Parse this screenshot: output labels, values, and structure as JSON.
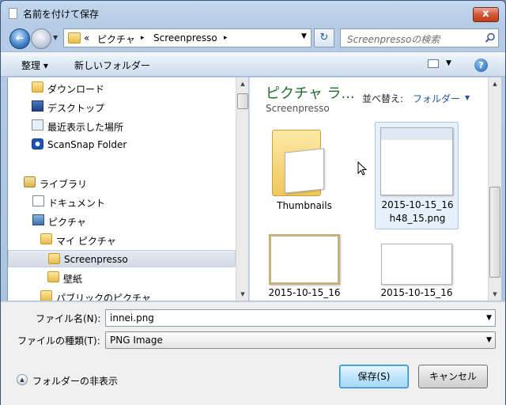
{
  "window": {
    "title": "名前を付けて保存",
    "close_label": "x"
  },
  "nav": {
    "back_label": "←",
    "forward_label": "→",
    "address": {
      "prefix": "«",
      "segments": [
        "ピクチャ",
        "Screenpresso"
      ],
      "separator": "▸"
    },
    "refresh_label": "↻",
    "search_placeholder": "Screenpressoの検索"
  },
  "toolbar": {
    "organize_label": "整理 ▾",
    "new_folder_label": "新しいフォルダー",
    "help_label": "?"
  },
  "sidebar": {
    "items": [
      {
        "label": "ダウンロード",
        "icon": "download-folder-icon"
      },
      {
        "label": "デスクトップ",
        "icon": "desktop-icon"
      },
      {
        "label": "最近表示した場所",
        "icon": "recent-places-icon"
      },
      {
        "label": "ScanSnap Folder",
        "icon": "scansnap-icon"
      },
      {
        "label": "ライブラリ",
        "icon": "library-icon"
      },
      {
        "label": "ドキュメント",
        "icon": "documents-icon"
      },
      {
        "label": "ピクチャ",
        "icon": "pictures-icon"
      },
      {
        "label": "マイ ピクチャ",
        "icon": "folder-icon"
      },
      {
        "label": "Screenpresso",
        "icon": "folder-icon",
        "selected": true
      },
      {
        "label": "壁紙",
        "icon": "folder-icon"
      },
      {
        "label": "パブリックのピクチャ",
        "icon": "folder-icon"
      }
    ]
  },
  "content": {
    "library_title": "ピクチャ ラ...",
    "library_subtitle": "Screenpresso",
    "sort_label": "並べ替え:",
    "sort_value": "フォルダー",
    "files": [
      {
        "name_line1": "Thumbnails",
        "name_line2": "",
        "type": "folder"
      },
      {
        "name_line1": "2015-10-15_16",
        "name_line2": "h48_15.png",
        "type": "image",
        "selected": true
      },
      {
        "name_line1": "2015-10-15_16",
        "name_line2": "",
        "type": "image"
      },
      {
        "name_line1": "2015-10-15_16",
        "name_line2": "",
        "type": "image"
      }
    ]
  },
  "form": {
    "filename_label": "ファイル名(N):",
    "filename_value": "innei.png",
    "filetype_label": "ファイルの種類(T):",
    "filetype_value": "PNG Image",
    "hide_folders_label": "フォルダーの非表示",
    "save_label": "保存(S)",
    "cancel_label": "キャンセル"
  }
}
